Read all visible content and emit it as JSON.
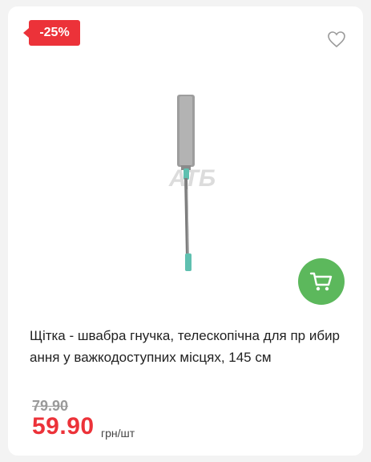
{
  "product": {
    "discount_badge": "-25%",
    "title": "Щітка - швабра гнучка, телескопічна для пр ибирання у важкодоступних місцях, 145 см",
    "old_price": "79.90",
    "price": "59.90",
    "unit": "грн/шт",
    "watermark": "АТБ"
  },
  "icons": {
    "favorite": "heart-icon",
    "cart": "cart-icon"
  },
  "colors": {
    "badge": "#ec3239",
    "price": "#ec3239",
    "cart_button": "#5cb85c",
    "old_price": "#9a9a9a"
  }
}
